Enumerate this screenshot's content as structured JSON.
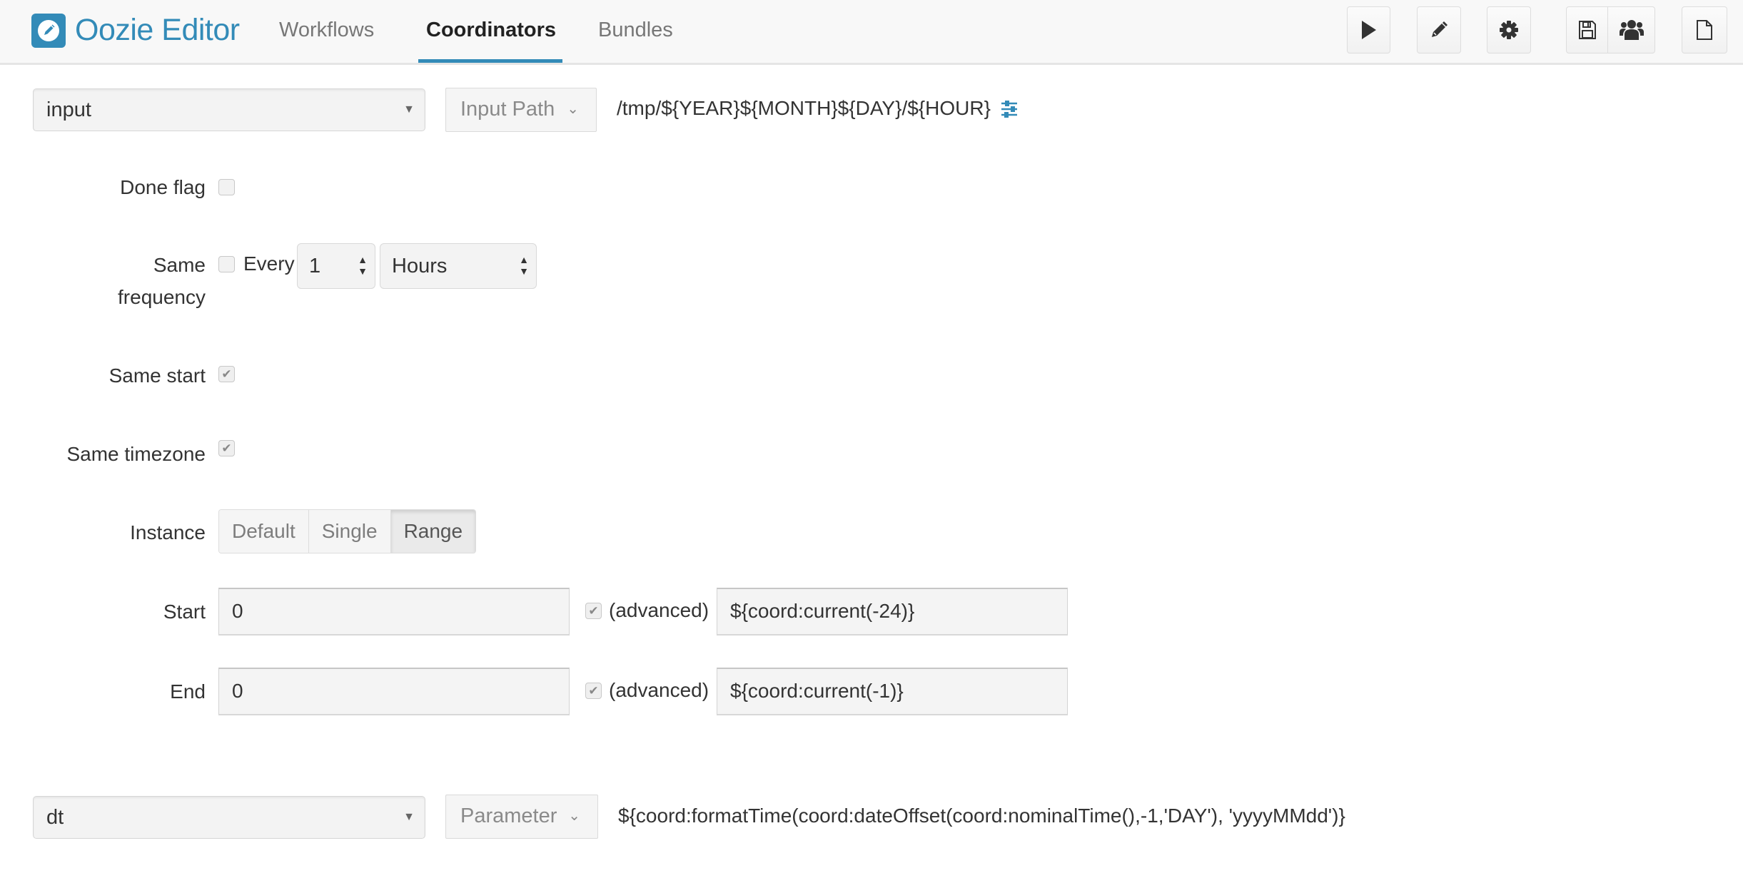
{
  "app": {
    "title": "Oozie Editor",
    "brand_color": "#338bb8"
  },
  "nav": {
    "tabs": [
      {
        "label": "Workflows",
        "active": false
      },
      {
        "label": "Coordinators",
        "active": true
      },
      {
        "label": "Bundles",
        "active": false
      }
    ]
  },
  "toolbar": {
    "buttons": [
      {
        "name": "run",
        "icon": "play-icon"
      },
      {
        "name": "edit",
        "icon": "pencil-icon"
      },
      {
        "name": "settings",
        "icon": "gear-icon"
      },
      {
        "name": "save",
        "icon": "floppy-disk-icon"
      },
      {
        "name": "share",
        "icon": "users-icon"
      },
      {
        "name": "new",
        "icon": "file-icon"
      }
    ]
  },
  "dataset": {
    "name_value": "input",
    "type_label": "Input Path",
    "path": "/tmp/${YEAR}${MONTH}${DAY}/${HOUR}",
    "path_icon": "sliders-icon"
  },
  "form": {
    "done_flag": {
      "label": "Done flag",
      "checked": false
    },
    "same_frequency": {
      "label_line1": "Same",
      "label_line2": "frequency",
      "checked": false,
      "every_label": "Every",
      "every_value": "1",
      "unit_value": "Hours"
    },
    "same_start": {
      "label": "Same start",
      "checked": true
    },
    "same_timezone": {
      "label": "Same timezone",
      "checked": true
    },
    "instance": {
      "label": "Instance",
      "options": [
        "Default",
        "Single",
        "Range"
      ],
      "selected": "Range"
    },
    "start": {
      "label": "Start",
      "value": "0",
      "advanced_checked": true,
      "advanced_label": "(advanced)",
      "advanced_value": "${coord:current(-24)}"
    },
    "end": {
      "label": "End",
      "value": "0",
      "advanced_checked": true,
      "advanced_label": "(advanced)",
      "advanced_value": "${coord:current(-1)}"
    }
  },
  "parameter": {
    "name_value": "dt",
    "type_label": "Parameter",
    "value": "${coord:formatTime(coord:dateOffset(coord:nominalTime(),-1,'DAY'), 'yyyyMMdd')}"
  }
}
